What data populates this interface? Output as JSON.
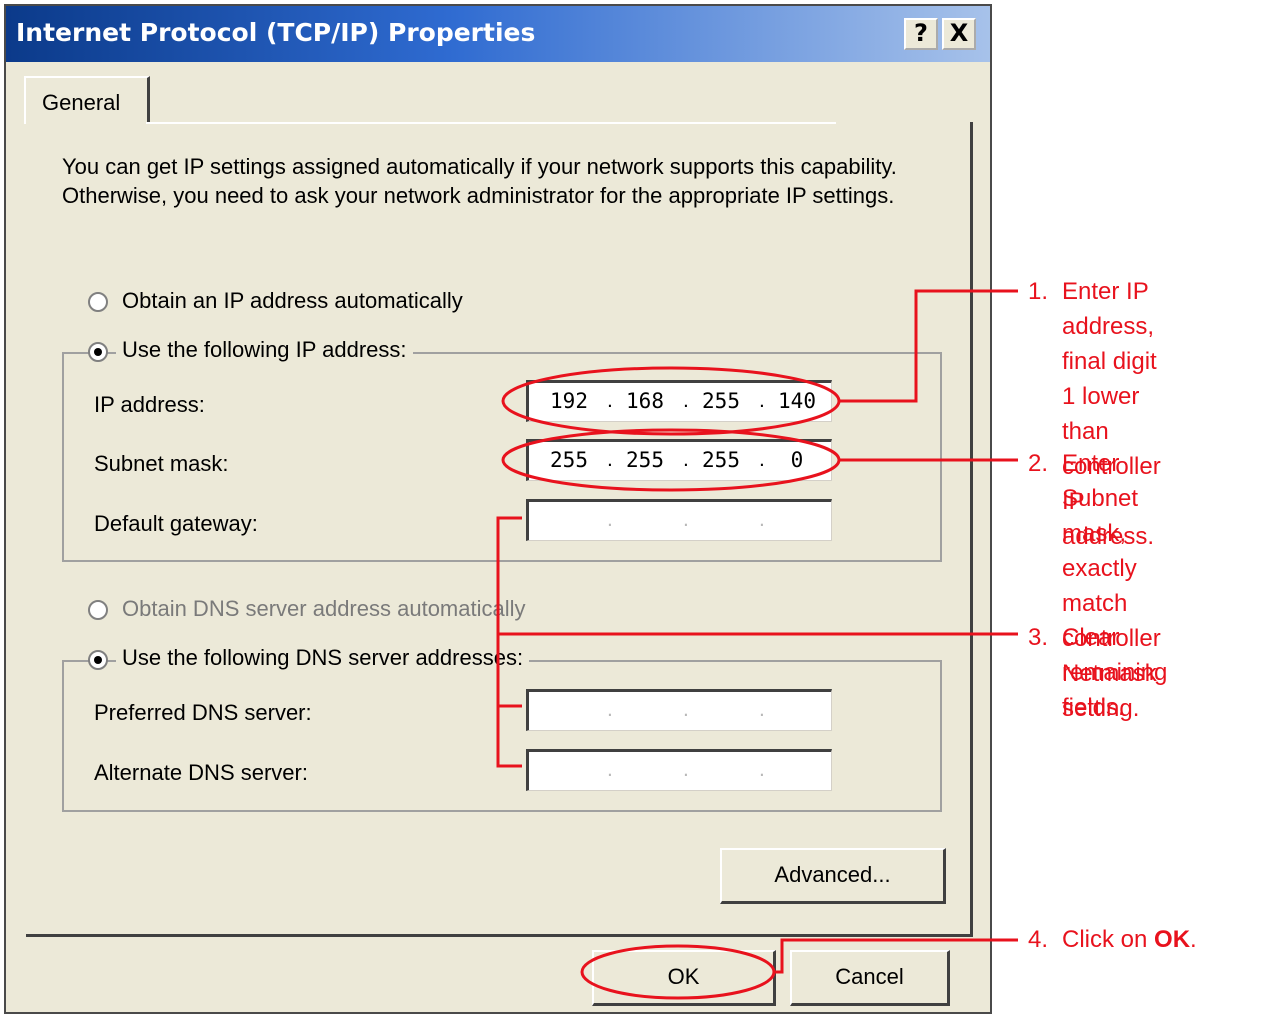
{
  "window": {
    "title": "Internet Protocol (TCP/IP) Properties",
    "help_button": "?",
    "close_button": "X"
  },
  "tabs": [
    {
      "label": "General"
    }
  ],
  "description": "You can get IP settings assigned automatically if your network supports this capability. Otherwise, you need to ask your network administrator for the appropriate IP settings.",
  "ip_section": {
    "auto_option": "Obtain an IP address automatically",
    "manual_option": "Use the following IP address:",
    "selected": "manual",
    "fields": [
      {
        "label": "IP address:",
        "octets": [
          "192",
          "168",
          "255",
          "140"
        ]
      },
      {
        "label": "Subnet mask:",
        "octets": [
          "255",
          "255",
          "255",
          "0"
        ]
      },
      {
        "label": "Default gateway:",
        "octets": [
          "",
          "",
          "",
          ""
        ]
      }
    ]
  },
  "dns_section": {
    "auto_option": "Obtain DNS server address automatically",
    "manual_option": "Use the following DNS server addresses:",
    "selected": "manual",
    "fields": [
      {
        "label": "Preferred DNS server:",
        "octets": [
          "",
          "",
          "",
          ""
        ]
      },
      {
        "label": "Alternate DNS server:",
        "octets": [
          "",
          "",
          "",
          ""
        ]
      }
    ]
  },
  "buttons": {
    "advanced": "Advanced...",
    "ok": "OK",
    "cancel": "Cancel"
  },
  "annotations": [
    {
      "number": "1.",
      "text": "Enter IP address,\nfinal digit 1 lower\nthan controller IP\naddress."
    },
    {
      "number": "2.",
      "text": "Enter Subnet\nmask, exactly\nmatch controller\nNetmask setting."
    },
    {
      "number": "3.",
      "text": "Clear remaining\nfields."
    },
    {
      "number": "4.",
      "text_prefix": "Click on ",
      "text_bold": "OK",
      "text_suffix": "."
    }
  ],
  "colors": {
    "annotation": "#e8121d",
    "title_bar": "#0b3a8a",
    "dialog_face": "#ece9d8"
  }
}
